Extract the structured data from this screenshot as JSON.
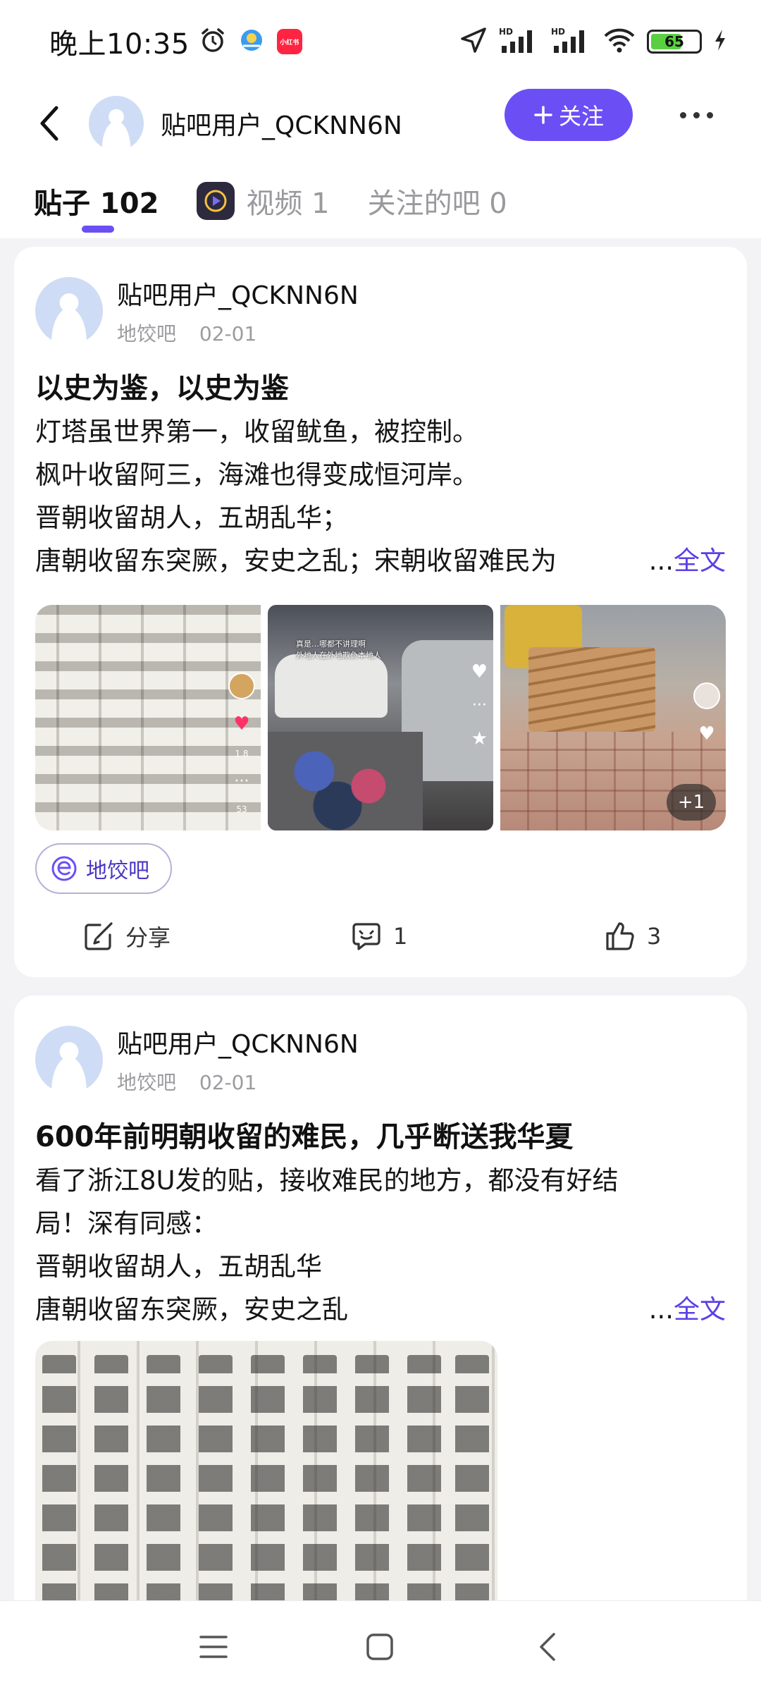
{
  "status_bar": {
    "time": "晚上10:35",
    "battery_percent": "65",
    "battery_level": 0.65,
    "app_badge_label": "小红书",
    "icons": [
      "alarm-icon",
      "app-icon",
      "app-badge-icon",
      "location-icon",
      "signal-hd-icon",
      "signal-hd-icon",
      "wifi-icon",
      "battery-icon",
      "charging-icon"
    ]
  },
  "header": {
    "username": "贴吧用户_QCKNN6N",
    "follow_label": "关注",
    "follow_color": "#6b4ff5"
  },
  "tabs": [
    {
      "label": "贴子 102",
      "active": true
    },
    {
      "label": "视频 1",
      "active": false
    },
    {
      "label": "关注的吧 0",
      "active": false
    }
  ],
  "posts": [
    {
      "author": "贴吧用户_QCKNN6N",
      "forum": "地饺吧",
      "date": "02-01",
      "title": "以史为鉴，以史为鉴",
      "lines": [
        "灯塔虽世界第一，收留鱿鱼，被控制。",
        "枫叶收留阿三，海滩也得变成恒河岸。",
        "晋朝收留胡人，五胡乱华；",
        "唐朝收留东突厥，安史之乱；宋朝收留难民为"
      ],
      "more_prefix": "...",
      "more_label": "全文",
      "image_extra": "+1",
      "image_side_counts": [
        "1.8",
        "53"
      ],
      "image_overlay": [
        "真是…哪都不讲理啊",
        "外地人在外地欺负本地人"
      ],
      "forum_tag": "地饺吧",
      "share_label": "分享",
      "comment_count": "1",
      "like_count": "3"
    },
    {
      "author": "贴吧用户_QCKNN6N",
      "forum": "地饺吧",
      "date": "02-01",
      "title": "600年前明朝收留的难民，几乎断送我华夏",
      "lines": [
        "看了浙江8U发的贴，接收难民的地方，都没有好结",
        "局！深有同感：",
        "晋朝收留胡人，五胡乱华",
        "唐朝收留东突厥，安史之乱"
      ],
      "more_prefix": "...",
      "more_label": "全文"
    }
  ]
}
